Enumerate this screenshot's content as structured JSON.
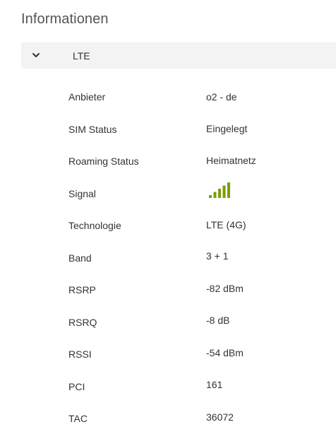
{
  "page": {
    "title": "Informationen"
  },
  "section": {
    "label": "LTE",
    "expanded": true,
    "toggle_icon": "chevron-down-icon"
  },
  "rows": [
    {
      "label": "Anbieter",
      "value": "o2 - de"
    },
    {
      "label": "SIM Status",
      "value": "Eingelegt"
    },
    {
      "label": "Roaming Status",
      "value": "Heimatnetz"
    },
    {
      "label": "Signal",
      "value": null
    },
    {
      "label": "Technologie",
      "value": "LTE (4G)"
    },
    {
      "label": "Band",
      "value": "3 + 1"
    },
    {
      "label": "RSRP",
      "value": "-82 dBm"
    },
    {
      "label": "RSRQ",
      "value": "-8 dB"
    },
    {
      "label": "RSSI",
      "value": "-54 dBm"
    },
    {
      "label": "PCI",
      "value": "161"
    },
    {
      "label": "TAC",
      "value": "36072"
    }
  ],
  "signal": {
    "icon": "signal-strength-icon",
    "bars_filled": 5,
    "bars_total": 5,
    "color": "#7a9e0a"
  },
  "colors": {
    "header_background": "#f3f3f3",
    "title_text": "#555555",
    "body_text": "#333333"
  }
}
